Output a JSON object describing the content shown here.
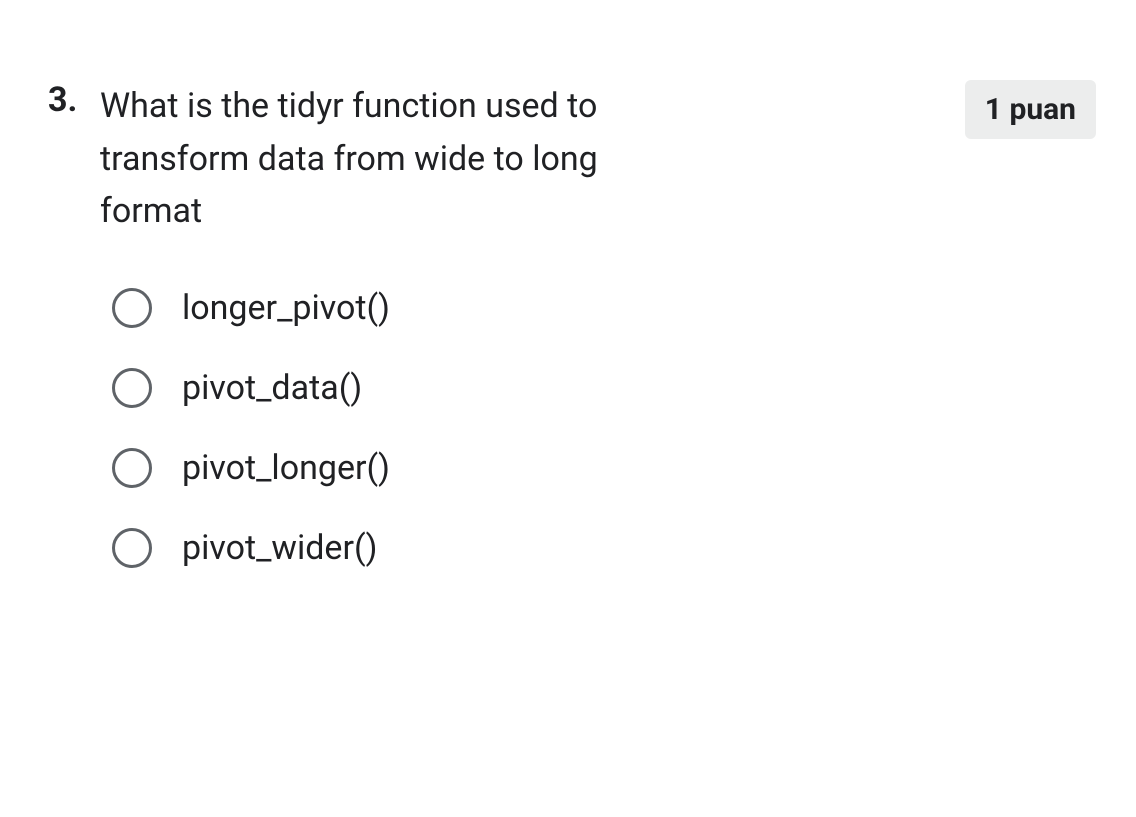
{
  "question": {
    "number": "3.",
    "text": "What is the tidyr function used to transform data from wide to long format",
    "points": "1 puan",
    "options": [
      {
        "label": "longer_pivot()"
      },
      {
        "label": "pivot_data()"
      },
      {
        "label": "pivot_longer()"
      },
      {
        "label": "pivot_wider()"
      }
    ]
  }
}
